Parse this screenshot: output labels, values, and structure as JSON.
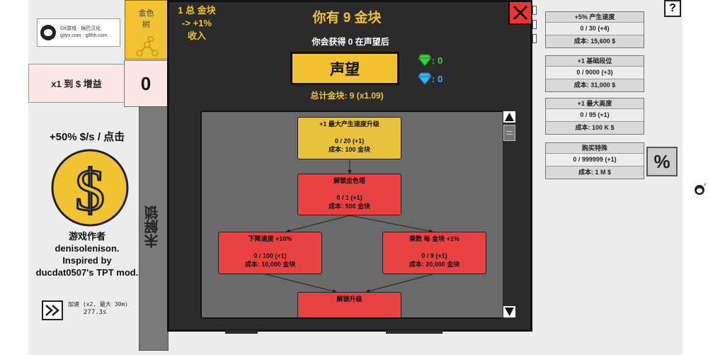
{
  "logo": {
    "line1": "Git游戏 · 锅巴汉化",
    "line2": "gityx.com · g8hh.com"
  },
  "gold_tree_tab": {
    "label": "金色\n树"
  },
  "income": {
    "label": "x1 到 $ 增益"
  },
  "counter": {
    "value": "0"
  },
  "side_tab": {
    "label": "未解锁"
  },
  "click": {
    "gain": "+50% $/s / 点击"
  },
  "coin_icon": "dollar-coin",
  "credits": {
    "line1": "游戏作者",
    "line2": "denisolenison.",
    "line3": "Inspired by",
    "line4": "ducdat0507's TPT mod."
  },
  "speedup": {
    "label": "加速 (x2, 最大 30m)",
    "time": "277.3s"
  },
  "prestige": {
    "info": "1 总 金块\n-> +1%\n收入",
    "title": "你有 9 金块",
    "gain": "你会获得 0 在声望后",
    "button": "声望",
    "green_gems": ": 0",
    "blue_gems": ": 0",
    "total": "总计金块: 9 (x1.09)"
  },
  "tree_nodes": [
    {
      "title": "+1 最大产生速度升级",
      "level": "0 / 20 (+1)",
      "cost": "成本: 100 金块",
      "status": "gold"
    },
    {
      "title": "解锁金色塔",
      "level": "0 / 1 (+1)",
      "cost": "成本: 500 金块",
      "status": "red"
    },
    {
      "title": "下降速度 +10%",
      "level": "0 / 100 (+1)",
      "cost": "成本: 10,000 金块",
      "status": "red"
    },
    {
      "title": "乘数 每 金块 +1%",
      "level": "0 / 9 (+1)",
      "cost": "成本: 20,000 金块",
      "status": "red"
    },
    {
      "title": "解锁升级",
      "level": "",
      "cost": "",
      "status": "red"
    }
  ],
  "upgrades": [
    {
      "title": "+5% 产生速度",
      "level": "0 / 30 (+4)",
      "cost": "成本: 15,600 $"
    },
    {
      "title": "+1 基础段位",
      "level": "0 / 9000 (+3)",
      "cost": "成本: 31,000 $"
    },
    {
      "title": "+1 最大高度",
      "level": "0 / 95 (+1)",
      "cost": "成本: 100 K $"
    },
    {
      "title": "购买特殊",
      "level": "0 / 999999 (+1)",
      "cost": "成本: 1 M $"
    }
  ],
  "percent_button": "%",
  "help_button": "?",
  "colors": {
    "gold": "#f1c232",
    "red_node": "#e84141",
    "panel": "#2b2b2b",
    "close": "#e33333"
  }
}
